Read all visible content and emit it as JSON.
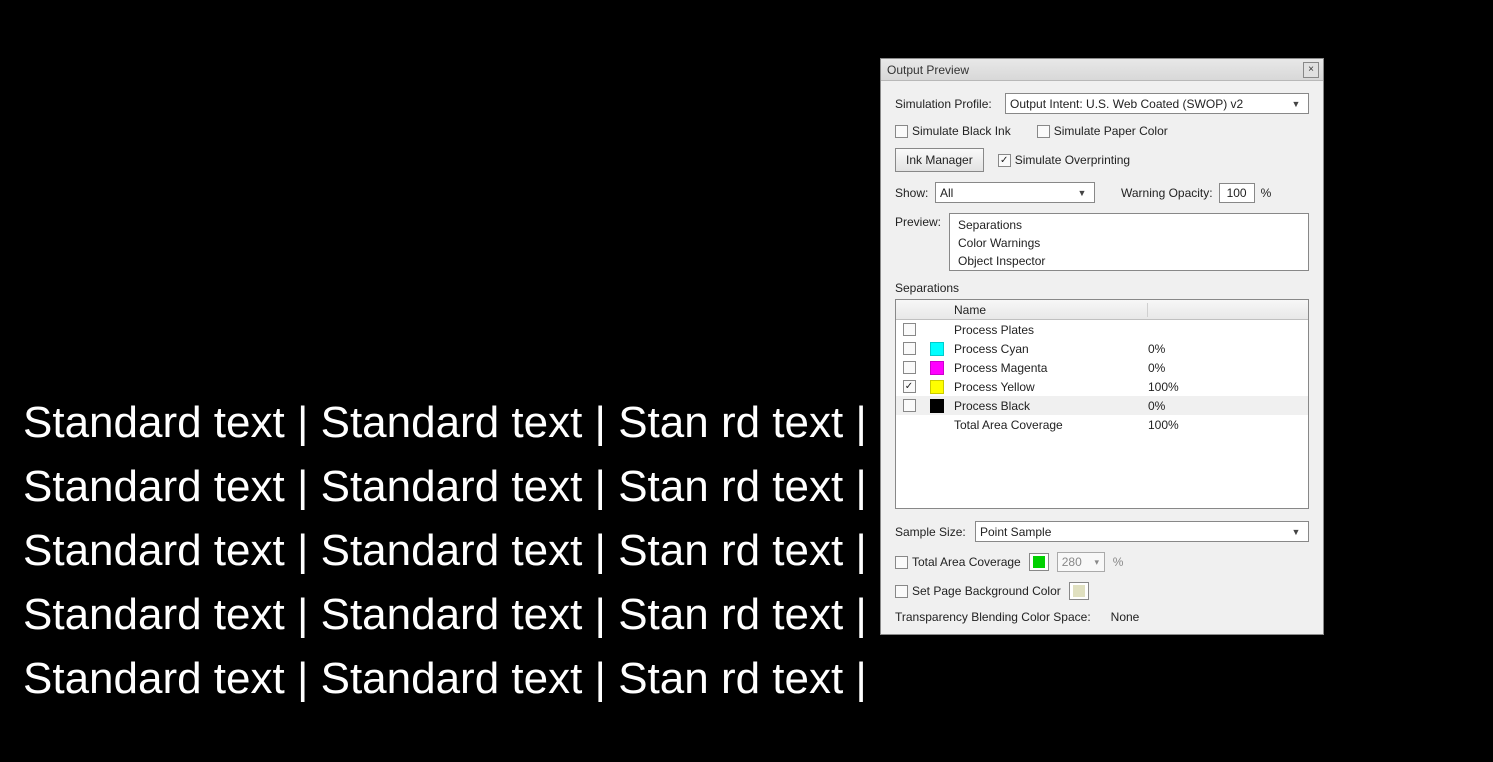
{
  "background_text_lines": [
    "Standard text | Standard text | Stan                                          rd text |",
    "Standard text | Standard text | Stan                                          rd text |",
    "Standard text | Standard text | Stan                                          rd text |",
    "Standard text | Standard text | Stan                                          rd text |",
    "Standard text | Standard text | Stan                                          rd text |"
  ],
  "dialog": {
    "title": "Output Preview",
    "simulation_profile_label": "Simulation Profile:",
    "simulation_profile_value": "Output Intent: U.S. Web Coated (SWOP) v2",
    "simulate_black_ink": "Simulate Black Ink",
    "simulate_paper_color": "Simulate Paper Color",
    "ink_manager_btn": "Ink Manager",
    "simulate_overprinting": "Simulate Overprinting",
    "show_label": "Show:",
    "show_value": "All",
    "warning_opacity_label": "Warning Opacity:",
    "warning_opacity_value": "100",
    "warning_opacity_unit": "%",
    "preview_label": "Preview:",
    "preview_items": [
      "Separations",
      "Color Warnings",
      "Object Inspector"
    ],
    "separations_label": "Separations",
    "sep_header_name": "Name",
    "sep_rows": [
      {
        "checked": false,
        "swatch": "",
        "name": "Process Plates",
        "value": ""
      },
      {
        "checked": false,
        "swatch": "#00FFFF",
        "name": "Process Cyan",
        "value": "0%"
      },
      {
        "checked": false,
        "swatch": "#FF00FF",
        "name": "Process Magenta",
        "value": "0%"
      },
      {
        "checked": true,
        "swatch": "#FFFF00",
        "name": "Process Yellow",
        "value": "100%"
      },
      {
        "checked": false,
        "swatch": "#000000",
        "name": "Process Black",
        "value": "0%"
      },
      {
        "checked": null,
        "swatch": "",
        "name": "Total Area Coverage",
        "value": "100%"
      }
    ],
    "sample_size_label": "Sample Size:",
    "sample_size_value": "Point Sample",
    "total_area_coverage": "Total Area Coverage",
    "tac_color": "#00D000",
    "tac_value": "280",
    "tac_unit": "%",
    "set_page_bg": "Set Page Background Color",
    "page_bg_color": "#e0e0c0",
    "blend_label": "Transparency Blending Color Space:",
    "blend_value": "None"
  }
}
